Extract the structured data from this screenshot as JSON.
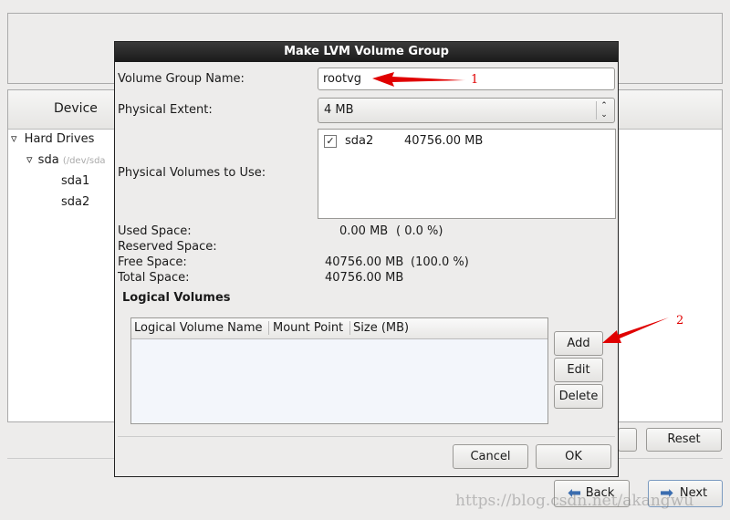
{
  "background": {
    "device_header": "Device",
    "tree": [
      {
        "label": "Hard Drives"
      },
      {
        "label": "sda",
        "hint": "(/dev/sda"
      },
      {
        "label": "sda1"
      },
      {
        "label": "sda2"
      }
    ],
    "reset_label": "Reset",
    "back_label": "Back",
    "next_label": "Next"
  },
  "dialog": {
    "title": "Make LVM Volume Group",
    "vg_name_label": "Volume Group Name:",
    "vg_name_value": "rootvg",
    "pe_label": "Physical Extent:",
    "pe_value": "4 MB",
    "pv_label": "Physical Volumes to Use:",
    "pv_items": [
      {
        "checked": true,
        "name": "sda2",
        "size": "40756.00 MB"
      }
    ],
    "used_label": "Used Space:",
    "used_value": "0.00 MB",
    "used_pct": "( 0.0 %)",
    "reserved_label": "Reserved Space:",
    "free_label": "Free Space:",
    "free_value": "40756.00 MB",
    "free_pct": "(100.0 %)",
    "total_label": "Total Space:",
    "total_value": "40756.00 MB",
    "lv_heading": "Logical Volumes",
    "lv_columns": [
      "Logical Volume Name",
      "Mount Point",
      "Size (MB)"
    ],
    "add_label": "Add",
    "edit_label": "Edit",
    "delete_label": "Delete",
    "cancel_label": "Cancel",
    "ok_label": "OK"
  },
  "annotations": {
    "one": "1",
    "two": "2",
    "color": "#e00000"
  },
  "watermark": "https://blog.csdn.net/akangwu"
}
